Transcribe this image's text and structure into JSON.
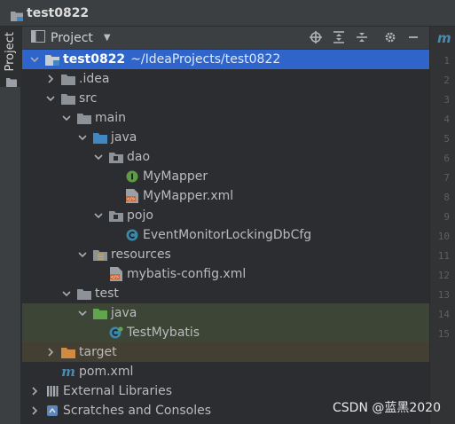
{
  "window": {
    "title": "test0822"
  },
  "sidebar": {
    "tab_label": "Project"
  },
  "panel": {
    "view_name": "Project",
    "dropdown_icon": "caret-down-icon",
    "toolbar": [
      {
        "name": "locate-icon"
      },
      {
        "name": "expand-all-icon"
      },
      {
        "name": "collapse-all-icon"
      },
      {
        "name": "gear-icon"
      },
      {
        "name": "minimize-icon"
      }
    ]
  },
  "tree": [
    {
      "label": "test0822",
      "path": "~/IdeaProjects/test0822",
      "icon": "module-folder-icon",
      "expanded": true,
      "selected": true,
      "bold": true
    },
    {
      "label": ".idea",
      "icon": "folder-icon",
      "expanded": false
    },
    {
      "label": "src",
      "icon": "folder-icon",
      "expanded": true
    },
    {
      "label": "main",
      "icon": "folder-icon",
      "expanded": true
    },
    {
      "label": "java",
      "icon": "source-root-folder-icon",
      "expanded": true
    },
    {
      "label": "dao",
      "icon": "package-icon",
      "expanded": true
    },
    {
      "label": "MyMapper",
      "icon": "interface-icon"
    },
    {
      "label": "MyMapper.xml",
      "icon": "xml-file-icon"
    },
    {
      "label": "pojo",
      "icon": "package-icon",
      "expanded": true
    },
    {
      "label": "EventMonitorLockingDbCfg",
      "icon": "class-icon"
    },
    {
      "label": "resources",
      "icon": "resources-folder-icon",
      "expanded": true
    },
    {
      "label": "mybatis-config.xml",
      "icon": "xml-file-icon"
    },
    {
      "label": "test",
      "icon": "folder-icon",
      "expanded": true
    },
    {
      "label": "java",
      "icon": "test-source-folder-icon",
      "expanded": true
    },
    {
      "label": "TestMybatis",
      "icon": "test-class-icon"
    },
    {
      "label": "target",
      "icon": "excluded-folder-icon",
      "expanded": false
    },
    {
      "label": "pom.xml",
      "icon": "maven-icon"
    },
    {
      "label": "External Libraries",
      "icon": "libraries-icon",
      "expanded": false
    },
    {
      "label": "Scratches and Consoles",
      "icon": "scratches-icon",
      "expanded": false
    }
  ],
  "gutter": {
    "file_icon": "m",
    "line_numbers": [
      "1",
      "2",
      "3",
      "4",
      "5",
      "6",
      "7",
      "8",
      "9",
      "10",
      "11",
      "12",
      "13",
      "14",
      "15"
    ]
  },
  "watermark": "CSDN @蓝黑2020",
  "colors": {
    "selection": "#2f65ca",
    "test_row": "#3c4536",
    "excluded_row": "#443f33",
    "folder": "#8c9298",
    "source_folder": "#3f88c2",
    "test_folder": "#5fa64e",
    "excluded_folder": "#d08a42"
  }
}
